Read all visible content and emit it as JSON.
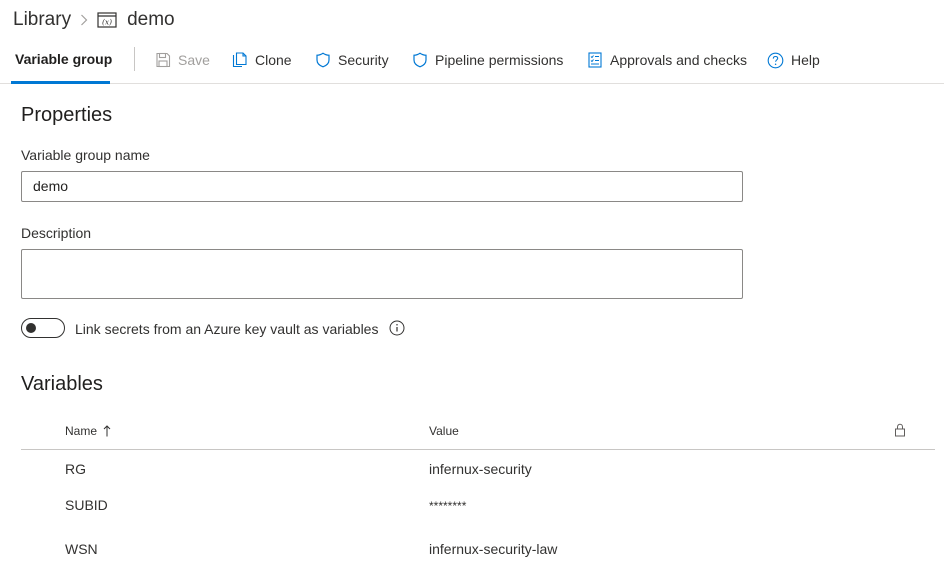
{
  "breadcrumb": {
    "root": "Library",
    "current": "demo",
    "icon": "variable-group-icon"
  },
  "toolbar": {
    "active_tab": "Variable group",
    "save_label": "Save",
    "clone_label": "Clone",
    "security_label": "Security",
    "pipeline_permissions_label": "Pipeline permissions",
    "approvals_label": "Approvals and checks",
    "help_label": "Help"
  },
  "properties": {
    "heading": "Properties",
    "name_label": "Variable group name",
    "name_value": "demo",
    "description_label": "Description",
    "description_value": "",
    "link_secrets_label": "Link secrets from an Azure key vault as variables",
    "link_secrets_enabled": false
  },
  "variables": {
    "heading": "Variables",
    "columns": {
      "name": "Name",
      "value": "Value"
    },
    "sort": "name-ascending",
    "rows": [
      {
        "name": "RG",
        "value": "infernux-security"
      },
      {
        "name": "SUBID",
        "value": "********"
      },
      {
        "name": "WSN",
        "value": "infernux-security-law"
      }
    ]
  },
  "colors": {
    "accent": "#0078d4",
    "text": "#323130",
    "disabled": "#a19f9d",
    "border": "#8a8886"
  }
}
